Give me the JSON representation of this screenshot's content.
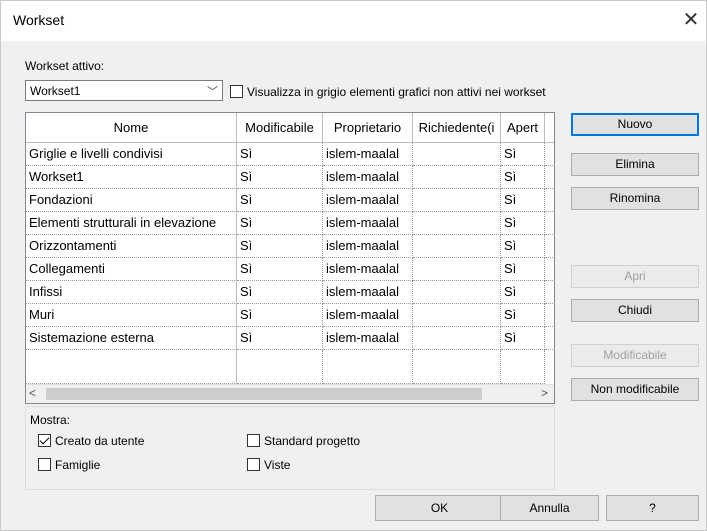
{
  "window": {
    "title": "Workset",
    "close_glyph": "✕"
  },
  "active_workset": {
    "label": "Workset attivo:",
    "value": "Workset1"
  },
  "gray_option": {
    "label": "Visualizza in grigio elementi grafici non attivi nei workset",
    "checked": false
  },
  "table": {
    "columns": [
      "Nome",
      "Modificabile",
      "Proprietario",
      "Richiedente(i",
      "Apert"
    ],
    "rows": [
      [
        "Griglie e livelli condivisi",
        "Sì",
        "islem-maalal",
        "",
        "Sì"
      ],
      [
        "Workset1",
        "Sì",
        "islem-maalal",
        "",
        "Sì"
      ],
      [
        "Fondazioni",
        "Sì",
        "islem-maalal",
        "",
        "Sì"
      ],
      [
        "Elementi strutturali in elevazione",
        "Sì",
        "islem-maalal",
        "",
        "Sì"
      ],
      [
        "Orizzontamenti",
        "Sì",
        "islem-maalal",
        "",
        "Sì"
      ],
      [
        "Collegamenti",
        "Sì",
        "islem-maalal",
        "",
        "Sì"
      ],
      [
        "Infissi",
        "Sì",
        "islem-maalal",
        "",
        "Sì"
      ],
      [
        "Muri",
        "Sì",
        "islem-maalal",
        "",
        "Sì"
      ],
      [
        "Sistemazione esterna",
        "Sì",
        "islem-maalal",
        "",
        "Sì"
      ]
    ],
    "scroll_left": "<",
    "scroll_right": ">"
  },
  "side_buttons": {
    "nuovo": "Nuovo",
    "elimina": "Elimina",
    "rinomina": "Rinomina",
    "apri": "Apri",
    "chiudi": "Chiudi",
    "modificabile": "Modificabile",
    "non_modificabile": "Non modificabile"
  },
  "show": {
    "label": "Mostra:",
    "creato_da_utente": {
      "label": "Creato da utente",
      "checked": true
    },
    "famiglie": {
      "label": "Famiglie",
      "checked": false
    },
    "standard_progetto": {
      "label": "Standard progetto",
      "checked": false
    },
    "viste": {
      "label": "Viste",
      "checked": false
    }
  },
  "footer": {
    "ok": "OK",
    "annulla": "Annulla",
    "help": "?"
  }
}
